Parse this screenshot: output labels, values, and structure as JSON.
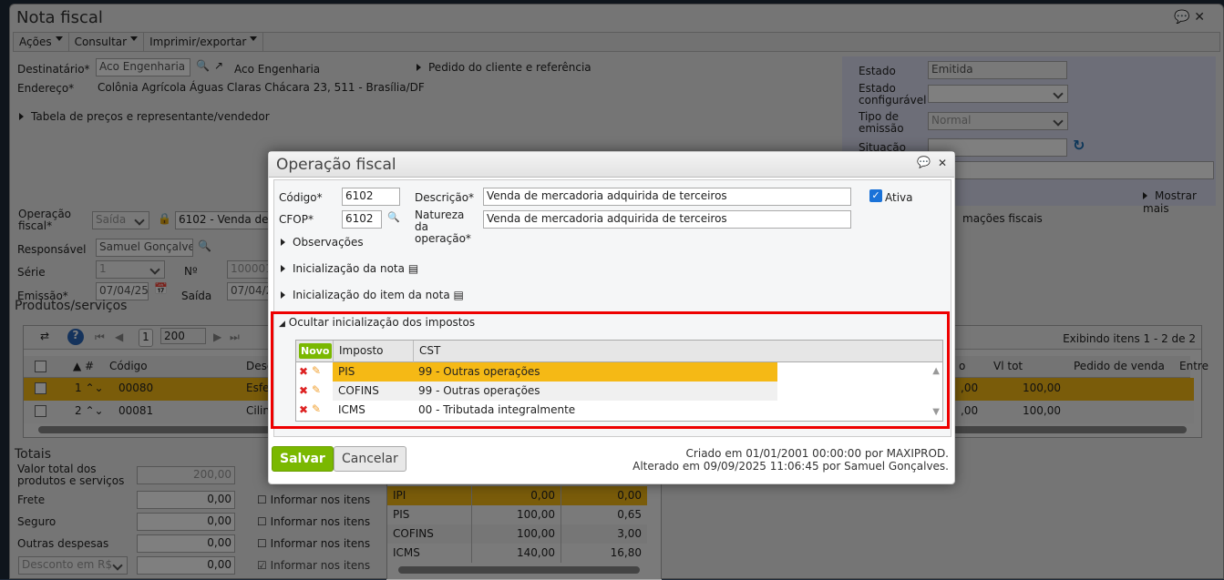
{
  "window": {
    "title": "Nota fiscal",
    "comment_icon": "speech-bubble-icon",
    "close_icon": "close-icon"
  },
  "menu": [
    {
      "label": "Ações"
    },
    {
      "label": "Consultar"
    },
    {
      "label": "Imprimir/exportar"
    }
  ],
  "header": {
    "destinatario_label": "Destinatário*",
    "destinatario_value": "Aco Engenharia",
    "destinatario_link": "Aco Engenharia",
    "endereco_label": "Endereço*",
    "endereco_value": "Colônia Agrícola Águas Claras Chácara 23, 511 - Brasília/DF",
    "pedido_toggle": "Pedido do cliente e referência",
    "tabela_toggle": "Tabela de preços e representante/vendedor",
    "operacao_label": "Operação fiscal*",
    "operacao_tipo": "Saída",
    "operacao_value": "6102 - Venda de m",
    "responsavel_label": "Responsável",
    "responsavel_value": "Samuel Gonçalves",
    "serie_label": "Série",
    "serie_value": "1",
    "numero_label": "Nº",
    "numero_value": "1000012",
    "emissao_label": "Emissão*",
    "emissao_value": "07/04/25",
    "saida_label": "Saída",
    "saida_value": "07/04/2",
    "info_fiscais": "mações fiscais"
  },
  "status_panel": {
    "estado_label": "Estado",
    "estado_value": "Emitida",
    "estado_conf_label": "Estado configurável",
    "estado_conf_value": "",
    "tipo_label": "Tipo de emissão",
    "tipo_value": "Normal",
    "situacao_label": "Situação",
    "situacao_value": "",
    "mostrar_mais": "Mostrar mais"
  },
  "products": {
    "title": "Produtos/serviços",
    "page": "1",
    "page_size": "200",
    "showing": "Exibindo itens 1 - 2 de 2",
    "columns": [
      "#",
      "Código",
      "Desc",
      "o",
      "Vl tot",
      "Pedido de venda",
      "Entre"
    ],
    "rows": [
      {
        "n": "1",
        "codigo": "00080",
        "desc": "Esfe",
        "o": ",00",
        "vltot": "100,00"
      },
      {
        "n": "2",
        "codigo": "00081",
        "desc": "Cilin",
        "o": ",00",
        "vltot": "100,00"
      }
    ]
  },
  "totais": {
    "title": "Totais",
    "rows": [
      {
        "label": "Valor total dos produtos e serviços",
        "value": "200,00"
      },
      {
        "label": "Frete",
        "value": "0,00",
        "check": "Informar nos itens"
      },
      {
        "label": "Seguro",
        "value": "0,00",
        "check": "Informar nos itens"
      },
      {
        "label": "Outras despesas",
        "value": "0,00",
        "check": "Informar nos itens"
      },
      {
        "label": "Desconto em R$",
        "value": "0,00",
        "check": "Informar nos itens"
      }
    ]
  },
  "impostos_resumo": [
    {
      "imposto": "IPI",
      "base": "0,00",
      "valor": "0,00"
    },
    {
      "imposto": "PIS",
      "base": "100,00",
      "valor": "0,65"
    },
    {
      "imposto": "COFINS",
      "base": "100,00",
      "valor": "3,00"
    },
    {
      "imposto": "ICMS",
      "base": "140,00",
      "valor": "16,80"
    }
  ],
  "dialog": {
    "title": "Operação fiscal",
    "codigo_label": "Código*",
    "codigo_value": "6102",
    "cfop_label": "CFOP*",
    "cfop_value": "6102",
    "descricao_label": "Descrição*",
    "descricao_value": "Venda de mercadoria adquirida de terceiros",
    "natureza_label": "Natureza da operação*",
    "natureza_value": "Venda de mercadoria adquirida de terceiros",
    "ativa_label": "Ativa",
    "ativa_checked": true,
    "observacoes": "Observações",
    "init_nota": "Inicialização da nota",
    "init_item": "Inicialização do item da nota",
    "ocultar": "Ocultar inicialização dos impostos",
    "novo": "Novo",
    "col_imposto": "Imposto",
    "col_cst": "CST",
    "rows": [
      {
        "imposto": "PIS",
        "cst": "99 - Outras operações"
      },
      {
        "imposto": "COFINS",
        "cst": "99 - Outras operações"
      },
      {
        "imposto": "ICMS",
        "cst": "00 - Tributada integralmente"
      }
    ],
    "salvar": "Salvar",
    "cancelar": "Cancelar",
    "criado": "Criado em 01/01/2001 00:00:00 por MAXIPROD.",
    "alterado": "Alterado em 09/09/2025 11:06:45 por Samuel Gonçalves."
  },
  "colors": {
    "accent_green": "#7ab800",
    "highlight": "#f5b915",
    "annotation_red": "#e00000",
    "status_panel": "#dadcf0"
  }
}
